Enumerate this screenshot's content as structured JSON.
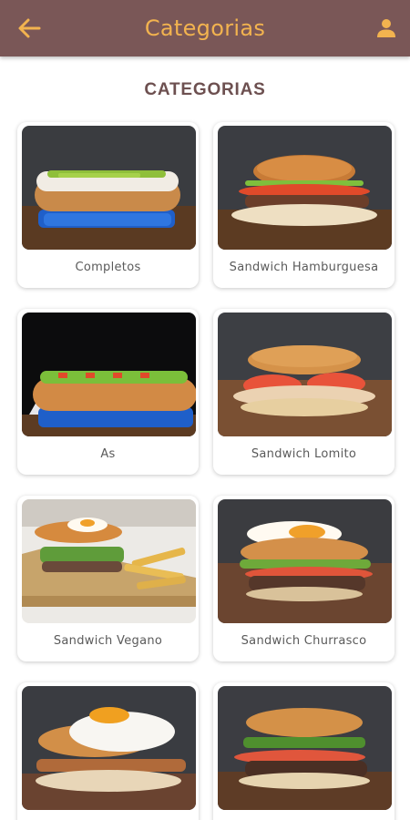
{
  "appbar": {
    "title": "Categorias",
    "back_icon": "arrow-left-icon",
    "user_icon": "person-icon",
    "background": "#7a5757",
    "accent": "#f2b34f"
  },
  "section_title": "CATEGORIAS",
  "categories": [
    {
      "label": "Completos"
    },
    {
      "label": "Sandwich Hamburguesa"
    },
    {
      "label": "As"
    },
    {
      "label": "Sandwich Lomito"
    },
    {
      "label": "Sandwich Vegano"
    },
    {
      "label": "Sandwich Churrasco"
    },
    {
      "label": ""
    },
    {
      "label": ""
    }
  ]
}
